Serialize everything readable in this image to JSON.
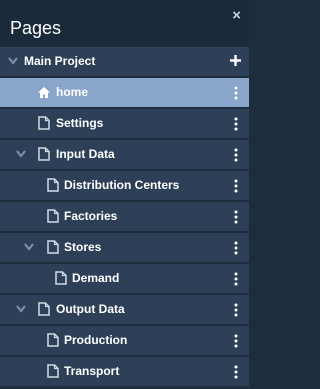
{
  "panel": {
    "title": "Pages",
    "close_glyph": "×"
  },
  "tree": {
    "root": {
      "label": "Main Project",
      "expanded": true
    },
    "items": [
      {
        "label": "home",
        "icon": "home-icon",
        "selected": true,
        "expandable": false
      },
      {
        "label": "Settings",
        "icon": "file-icon",
        "selected": false,
        "expandable": false
      },
      {
        "label": "Input Data",
        "icon": "file-icon",
        "selected": false,
        "expandable": true,
        "expanded": true
      },
      {
        "label": "Distribution Centers",
        "icon": "file-icon",
        "selected": false,
        "expandable": false
      },
      {
        "label": "Factories",
        "icon": "file-icon",
        "selected": false,
        "expandable": false
      },
      {
        "label": "Stores",
        "icon": "file-icon",
        "selected": false,
        "expandable": true,
        "expanded": true
      },
      {
        "label": "Demand",
        "icon": "file-icon",
        "selected": false,
        "expandable": false
      },
      {
        "label": "Output Data",
        "icon": "file-icon",
        "selected": false,
        "expandable": true,
        "expanded": true
      },
      {
        "label": "Production",
        "icon": "file-icon",
        "selected": false,
        "expandable": false
      },
      {
        "label": "Transport",
        "icon": "file-icon",
        "selected": false,
        "expandable": false
      }
    ]
  },
  "colors": {
    "panel_bg": "#1d2d3e",
    "row_bg": "#2e4057",
    "selected_row_bg": "#89a5c9",
    "text": "#ffffff",
    "icon": "#d0dae4"
  }
}
